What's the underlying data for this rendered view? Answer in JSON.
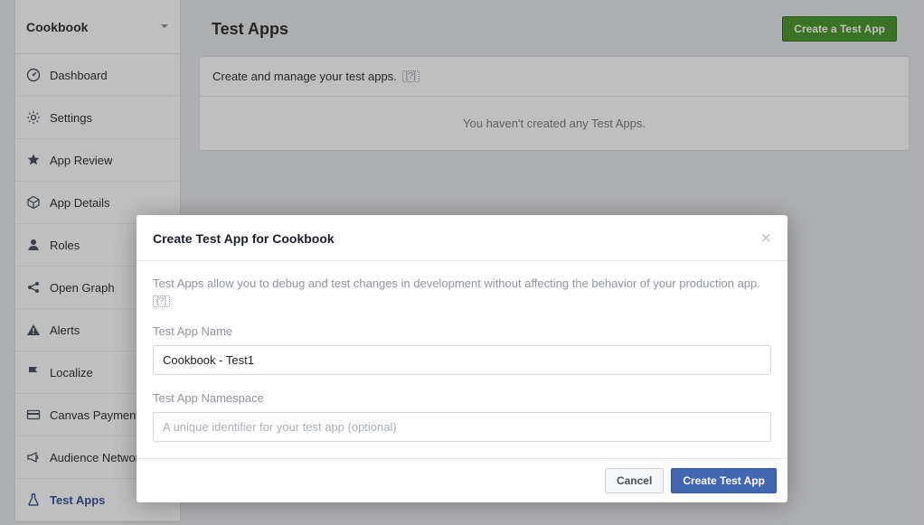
{
  "app_name": "Cookbook",
  "sidebar": {
    "items": [
      {
        "label": "Dashboard"
      },
      {
        "label": "Settings"
      },
      {
        "label": "App Review"
      },
      {
        "label": "App Details"
      },
      {
        "label": "Roles"
      },
      {
        "label": "Open Graph"
      },
      {
        "label": "Alerts"
      },
      {
        "label": "Localize"
      },
      {
        "label": "Canvas Payments"
      },
      {
        "label": "Audience Network"
      },
      {
        "label": "Test Apps"
      }
    ]
  },
  "page": {
    "title": "Test Apps",
    "create_button": "Create a Test App",
    "description": "Create and manage your test apps.",
    "help_icon": "[?]",
    "empty_state": "You haven't created any Test Apps."
  },
  "modal": {
    "title": "Create Test App for Cookbook",
    "description": "Test Apps allow you to debug and test changes in development without affecting the behavior of your production app.",
    "help_icon": "[?]",
    "name_label": "Test App Name",
    "name_value": "Cookbook - Test1",
    "namespace_label": "Test App Namespace",
    "namespace_placeholder": "A unique identifier for your test app (optional)",
    "cancel": "Cancel",
    "submit": "Create Test App"
  }
}
